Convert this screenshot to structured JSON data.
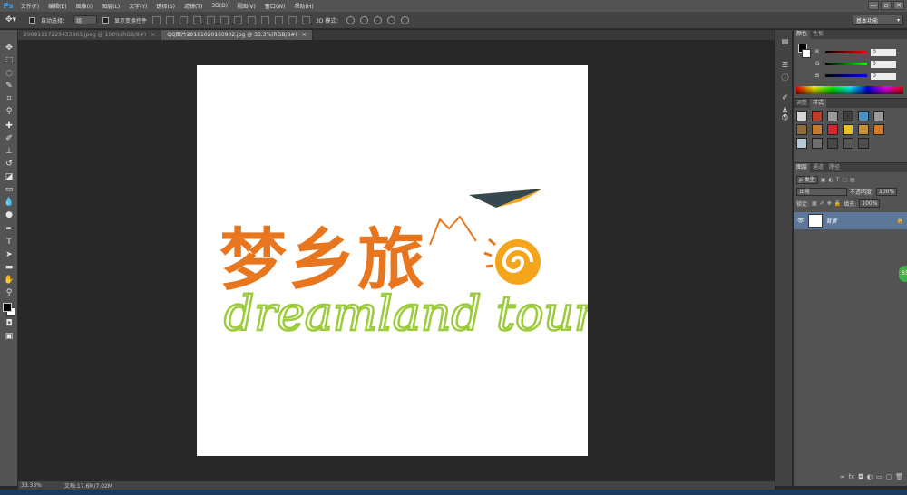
{
  "app": {
    "logo": "Ps"
  },
  "menu": [
    "文件(F)",
    "编辑(E)",
    "图像(I)",
    "图层(L)",
    "文字(Y)",
    "选择(S)",
    "滤镜(T)",
    "3D(D)",
    "视图(V)",
    "窗口(W)",
    "帮助(H)"
  ],
  "window_controls": {
    "minimize": "—",
    "restore": "▫",
    "close": "✕"
  },
  "options": {
    "auto_select_label": "自动选择：",
    "auto_select_value": "组",
    "show_transform_label": "显示变换控件",
    "mode_3d_label": "3D 模式：",
    "workspace": "基本功能"
  },
  "tabs": [
    {
      "label": "20091117223433863.jpeg @ 100%(RGB/8#)",
      "close": "×"
    },
    {
      "label": "QQ图片20161020160902.jpg @ 33.3%(RGB/8#)",
      "close": "×"
    }
  ],
  "status": {
    "zoom": "33.33%",
    "doc": "文档:17.6M/7.02M"
  },
  "panels": {
    "color_tabs": [
      "颜色",
      "色板"
    ],
    "channels": [
      {
        "label": "R",
        "value": "0",
        "gradient": "linear-gradient(90deg,#000,#ff0000)"
      },
      {
        "label": "G",
        "value": "0",
        "gradient": "linear-gradient(90deg,#000,#00ff00)"
      },
      {
        "label": "B",
        "value": "0",
        "gradient": "linear-gradient(90deg,#000,#0000ff)"
      }
    ],
    "style_tabs": [
      "调整",
      "样式"
    ],
    "style_colors": [
      "#d7d7d7",
      "#c0392b",
      "#9b9b9b",
      "#3a3a3a",
      "#4a90c2",
      "#9c9c9c",
      "#8d6e3c",
      "#c97a2e",
      "#d8262c",
      "#e6c229",
      "#c99237",
      "#d07a2a",
      "#b6c9d6",
      "#6d6d6d",
      "#474747",
      "#555555",
      "#4d4d4d",
      ""
    ],
    "layer_tabs": [
      "图层",
      "通道",
      "路径"
    ],
    "filter_label": "ρ 类型",
    "blend_mode": "正常",
    "opacity_label": "不透明度:",
    "opacity_value": "100%",
    "lock_label": "锁定:",
    "fill_label": "填充:",
    "fill_value": "100%",
    "layer_name": "背景"
  },
  "logo_art": {
    "chinese": "梦乡旅",
    "english": "dreamland tour",
    "orange": "#e8761e",
    "green": "#9ccc3c",
    "dark": "#37474f",
    "accent": "#f4a51c"
  },
  "badge": "55"
}
